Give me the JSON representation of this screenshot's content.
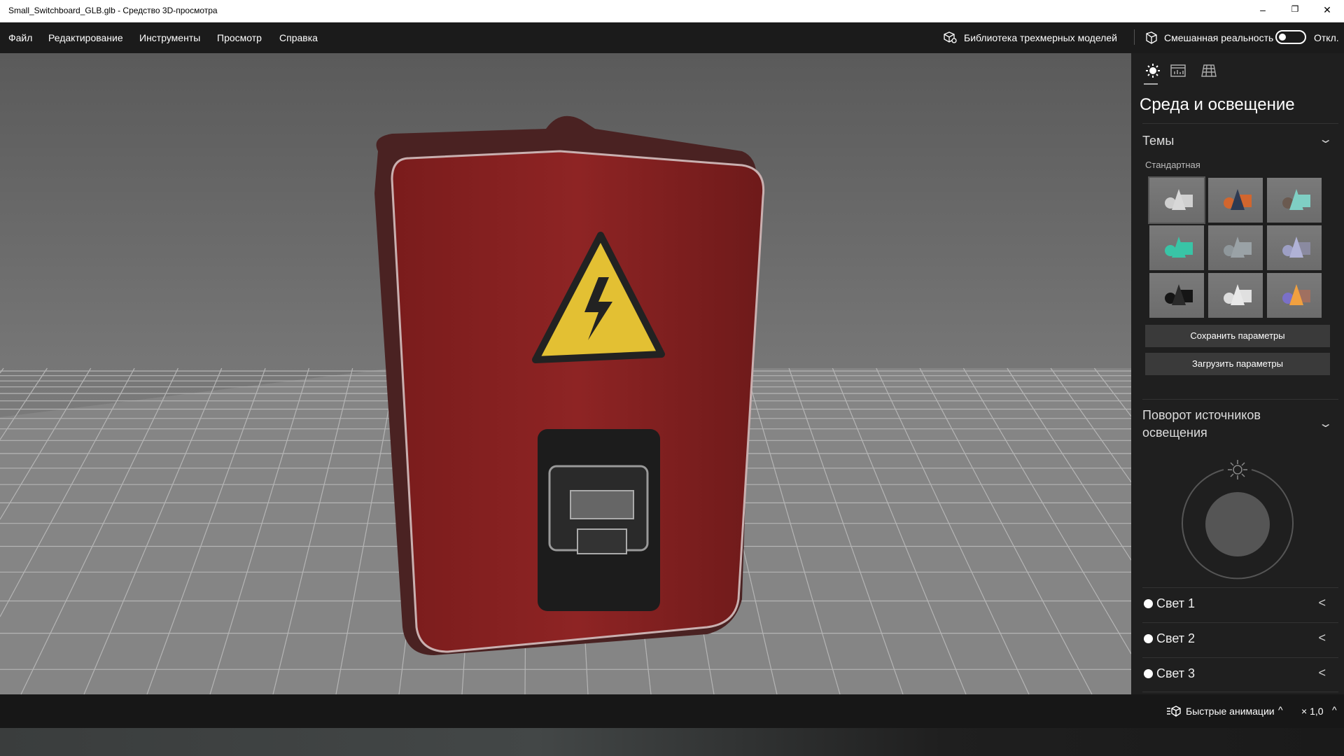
{
  "window": {
    "title": "Small_Switchboard_GLB.glb - Средство 3D-просмотра",
    "controls": {
      "minimize": "–",
      "restore": "❐",
      "close": "✕"
    }
  },
  "menu": {
    "items": [
      "Файл",
      "Редактирование",
      "Инструменты",
      "Просмотр",
      "Справка"
    ],
    "library_label": "Библиотека трехмерных моделей",
    "mixed_reality_label": "Смешанная реальность",
    "toggle_state": "Откл."
  },
  "panel": {
    "tabs": [
      "environment-lighting",
      "stats",
      "grid"
    ],
    "title": "Среда и освещение",
    "themes": {
      "header": "Темы",
      "group": "Стандартная",
      "items": [
        {
          "cone": "#d8d8d8",
          "sphere": "#cfcfcf",
          "box": "#d0d0d0"
        },
        {
          "cone": "#2e3a52",
          "sphere": "#d2662e",
          "box": "#d2662e"
        },
        {
          "cone": "#7fcfc4",
          "sphere": "#6a5a50",
          "box": "#7fcfc4"
        },
        {
          "cone": "#39c4a6",
          "sphere": "#39c4a6",
          "box": "#39c4a6"
        },
        {
          "cone": "#9aa2a6",
          "sphere": "#8f979b",
          "box": "#9aa2a6"
        },
        {
          "cone": "#b0b2d6",
          "sphere": "#9d9fc4",
          "box": "#8a8aa0"
        },
        {
          "cone": "#2a2a2a",
          "sphere": "#151515",
          "box": "#151515"
        },
        {
          "cone": "#e8e8e8",
          "sphere": "#dcdcdc",
          "box": "#e0e0e0"
        },
        {
          "cone": "#f0a040",
          "sphere": "#7a70c8",
          "box": "#a07060"
        }
      ]
    },
    "save_button": "Сохранить параметры",
    "load_button": "Загрузить параметры",
    "rotation": {
      "header": "Поворот источников освещения"
    },
    "lights": [
      "Свет 1",
      "Свет 2",
      "Свет 3"
    ]
  },
  "bottom": {
    "quick_animations": "Быстрые анимации",
    "speed": "× 1,0"
  }
}
